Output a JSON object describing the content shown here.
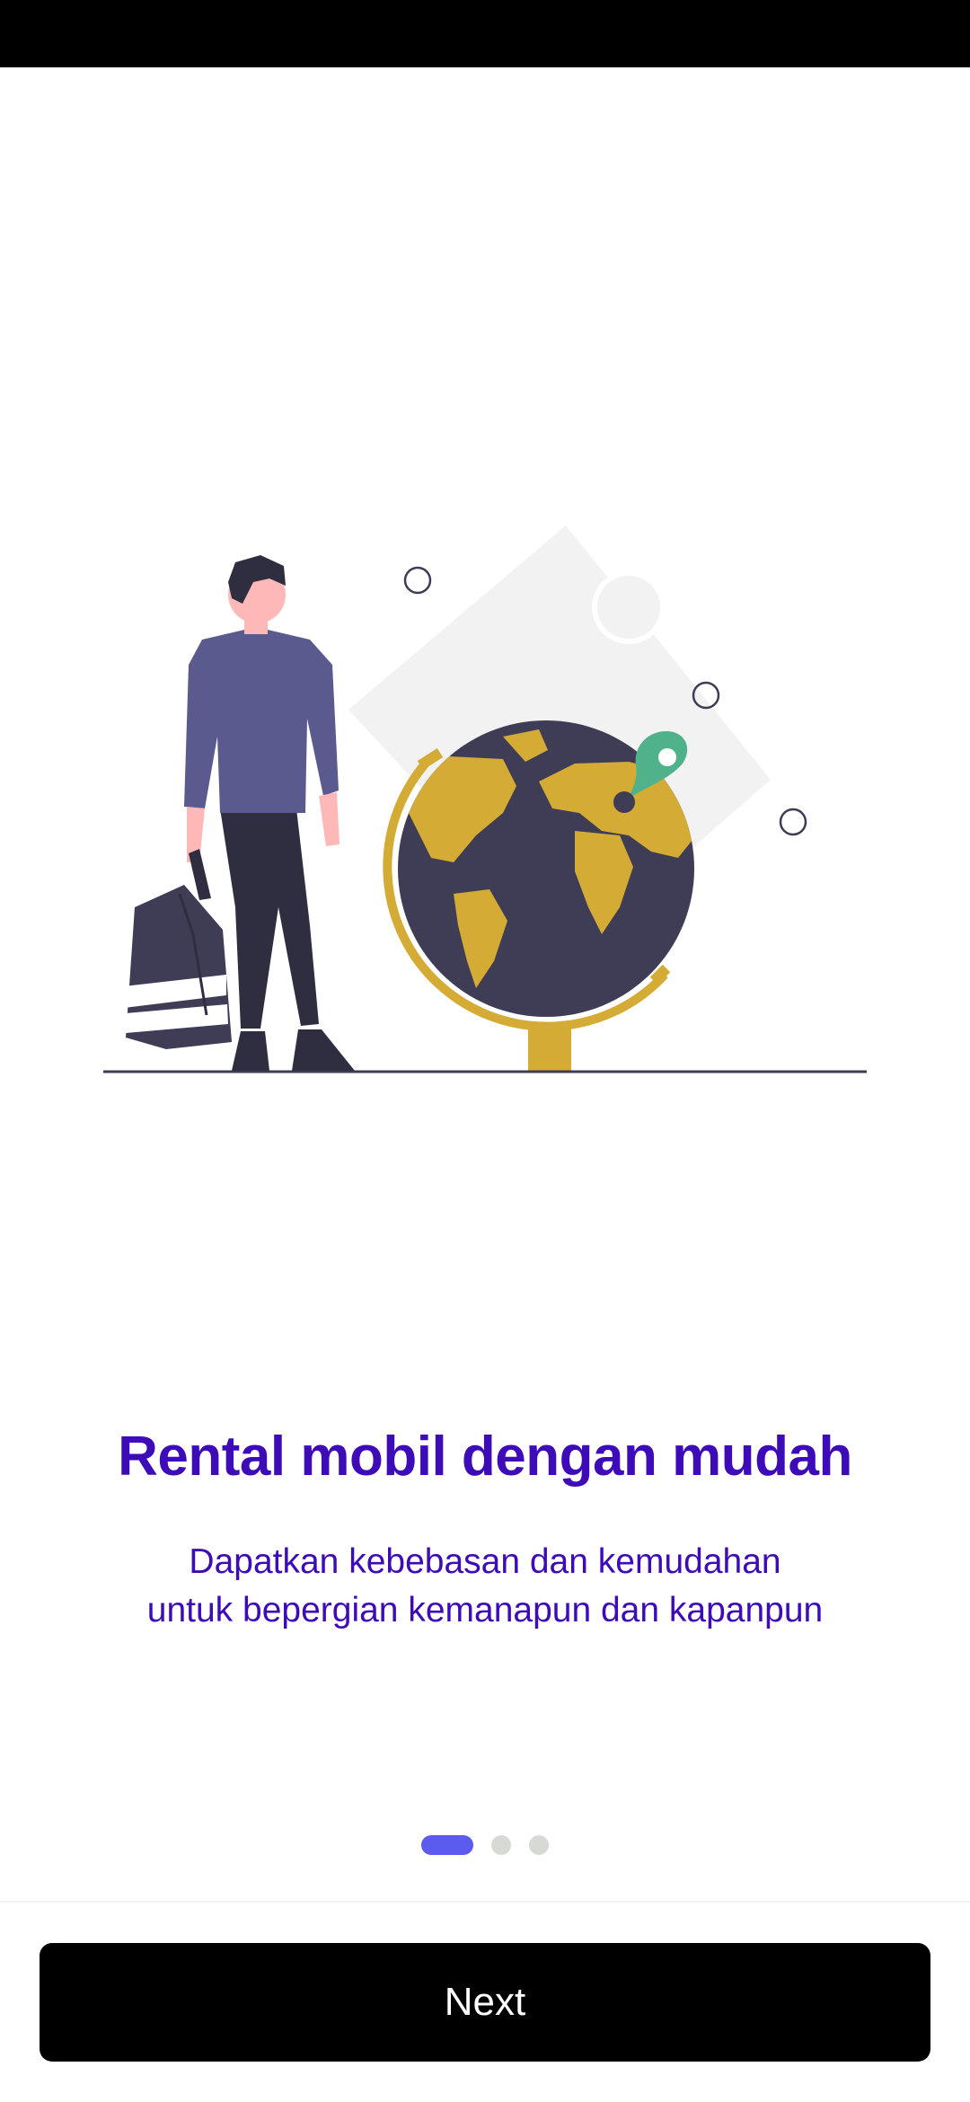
{
  "onboarding": {
    "title": "Rental mobil dengan mudah",
    "subtitle_line1": "Dapatkan kebebasan dan kemudahan",
    "subtitle_line2": "untuk bepergian kemanapun dan kapanpun",
    "pages_total": 3,
    "current_page": 1,
    "next_label": "Next"
  },
  "colors": {
    "title": "#3d0bb8",
    "subtitle": "#3d0bb8",
    "dot_active": "#5b5bf0",
    "dot_inactive": "#d6d9d4",
    "button_bg": "#000000",
    "button_text": "#ffffff",
    "globe_land": "#d4ab35",
    "globe_ocean": "#3f3d56",
    "pin": "#4fb28a"
  },
  "illustration": {
    "icon": "traveler-globe-illustration"
  }
}
